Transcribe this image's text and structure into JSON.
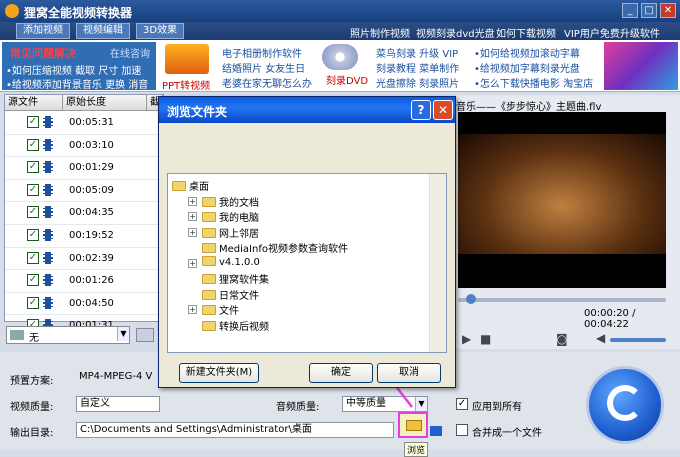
{
  "app": {
    "title": "狸窝全能视频转换器"
  },
  "menu": {
    "tabs": [
      "添加视频",
      "视频编辑",
      "3D效果"
    ],
    "links": [
      "照片制作视频",
      "视频刻录dvd光盘",
      "如何下载视频",
      "VIP用户免费升级软件"
    ]
  },
  "ads": {
    "faq_title": "常见问题解决",
    "faq_online": "在线咨询",
    "faq_links": [
      "•如何压缩视频 截取 尺寸 加速",
      "•给视频添加背景音乐 更换 消音"
    ],
    "ppt_label": "PPT转视频",
    "mid": [
      "电子相册制作软件",
      "结婚照片 女友生日",
      "老婆在家无聊怎么办"
    ],
    "dvd_label": "刻录DVD",
    "col2": [
      "菜鸟刻录 升级 VIP",
      "刻录教程 菜单制作",
      "光盘擦除 刻录照片"
    ],
    "col3": [
      "•如何给视频加滚动字幕",
      "•给视频加字幕刻录光盘",
      "•怎么下载快播电影 淘宝店"
    ]
  },
  "filelist": {
    "headers": [
      "源文件",
      "原始长度",
      "截"
    ],
    "rows": [
      {
        "checked": true,
        "duration": "00:05:31"
      },
      {
        "checked": true,
        "duration": "00:03:10"
      },
      {
        "checked": true,
        "duration": "00:01:29"
      },
      {
        "checked": true,
        "duration": "00:05:09"
      },
      {
        "checked": true,
        "duration": "00:04:35"
      },
      {
        "checked": true,
        "duration": "00:19:52"
      },
      {
        "checked": true,
        "duration": "00:02:39"
      },
      {
        "checked": true,
        "duration": "00:01:26"
      },
      {
        "checked": true,
        "duration": "00:04:50"
      },
      {
        "checked": true,
        "duration": "00:01:31"
      }
    ],
    "subtitle_value": "无"
  },
  "player": {
    "now_playing": "音乐——《步步惊心》主题曲.flv",
    "time": "00:00:20 / 00:04:22"
  },
  "settings": {
    "preset_label": "预置方案:",
    "preset_value": "MP4-MPEG-4 V",
    "vq_label": "视频质量:",
    "vq_value": "自定义",
    "aq_label": "音频质量:",
    "aq_value": "中等质量",
    "apply_all": "应用到所有",
    "out_label": "输出目录:",
    "out_value": "C:\\Documents and Settings\\Administrator\\桌面",
    "merge": "合并成一个文件",
    "browse_label": "浏览"
  },
  "dialog": {
    "title": "浏览文件夹",
    "help": "?",
    "close": "✕",
    "tree": [
      {
        "label": "桌面",
        "level": 0,
        "exp": ""
      },
      {
        "label": "我的文档",
        "level": 1,
        "exp": "+"
      },
      {
        "label": "我的电脑",
        "level": 1,
        "exp": "+"
      },
      {
        "label": "网上邻居",
        "level": 1,
        "exp": "+"
      },
      {
        "label": "MediaInfo视频参数查询软件",
        "level": 1,
        "exp": ""
      },
      {
        "label": "v4.1.0.0",
        "level": 1,
        "exp": "+"
      },
      {
        "label": "狸窝软件集",
        "level": 1,
        "exp": ""
      },
      {
        "label": "日常文件",
        "level": 1,
        "exp": ""
      },
      {
        "label": "文件",
        "level": 1,
        "exp": "+"
      },
      {
        "label": "转换后视频",
        "level": 1,
        "exp": ""
      }
    ],
    "new_folder": "新建文件夹(M)",
    "ok": "确定",
    "cancel": "取消"
  },
  "colors": {
    "accent": "#2f6db5",
    "annotation": "#e040e0"
  }
}
